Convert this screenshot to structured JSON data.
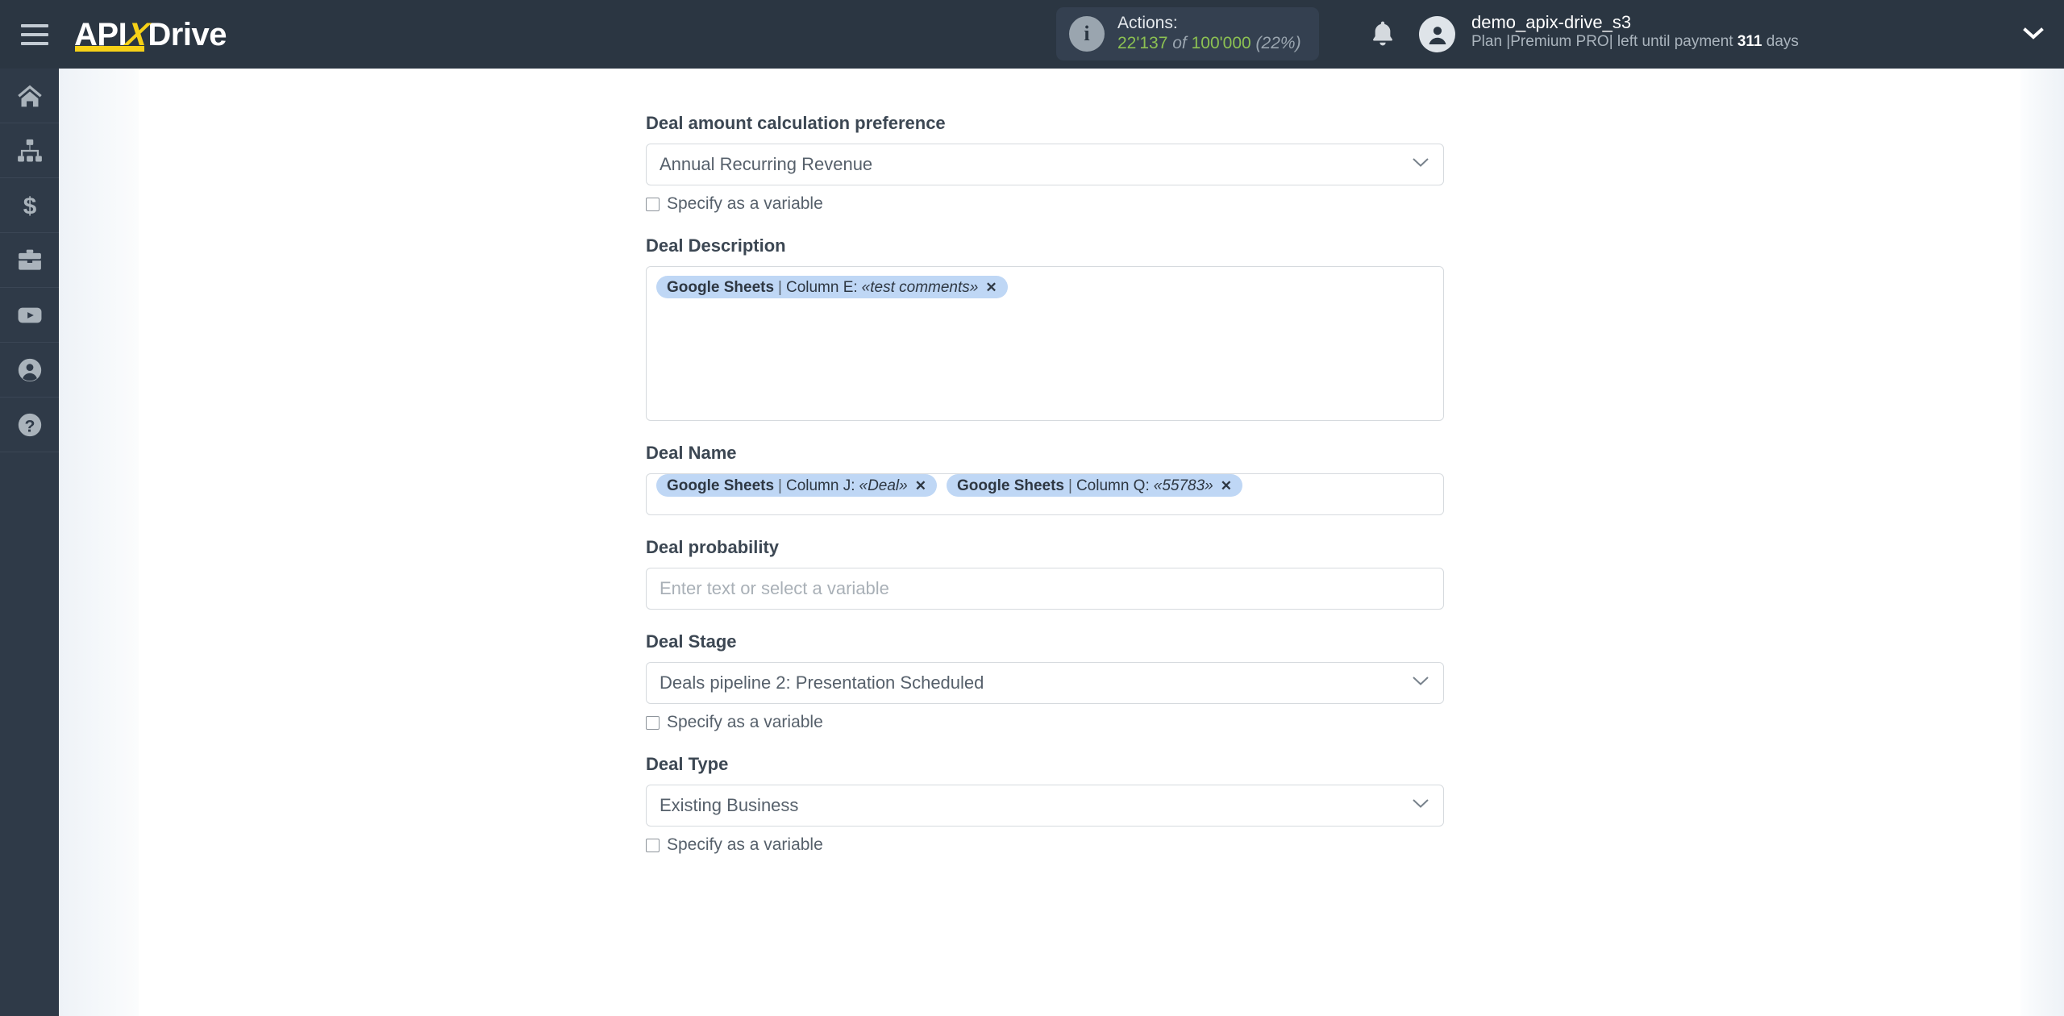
{
  "header": {
    "logo": {
      "part1": "API",
      "part2": "X",
      "part3": "Drive"
    },
    "menu_icon": "hamburger-icon",
    "actions": {
      "title": "Actions:",
      "used": "22'137",
      "of": "of",
      "total": "100'000",
      "percent": "(22%)",
      "green_color": "#8cc152"
    },
    "notifications_icon": "bell-icon",
    "user": {
      "name": "demo_apix-drive_s3",
      "plan_prefix": "Plan |",
      "plan_name": "Premium PRO",
      "plan_mid": "| left until payment",
      "days_value": "311",
      "days_suffix": "days"
    },
    "dropdown_icon": "chevron-down-icon"
  },
  "sidebar": {
    "items": [
      {
        "name": "home",
        "icon": "home-icon"
      },
      {
        "name": "connections",
        "icon": "sitemap-icon"
      },
      {
        "name": "billing",
        "icon": "dollar-icon"
      },
      {
        "name": "services",
        "icon": "briefcase-icon"
      },
      {
        "name": "video",
        "icon": "youtube-icon"
      },
      {
        "name": "account",
        "icon": "user-circle-icon"
      },
      {
        "name": "help",
        "icon": "question-circle-icon"
      }
    ]
  },
  "form": {
    "checkbox_label": "Specify as a variable",
    "fields": [
      {
        "id": "deal-amount-calculation-preference",
        "label": "Deal amount calculation preference",
        "type": "select",
        "value": "Annual Recurring Revenue",
        "has_checkbox": true
      },
      {
        "id": "deal-description",
        "label": "Deal Description",
        "type": "tagarea-tall",
        "tags": [
          {
            "source": "Google Sheets",
            "sep": "|",
            "column": "Column E:",
            "value": "«test comments»",
            "remove": "✕"
          }
        ],
        "has_checkbox": false
      },
      {
        "id": "deal-name",
        "label": "Deal Name",
        "type": "tagarea-short",
        "tags": [
          {
            "source": "Google Sheets",
            "sep": "|",
            "column": "Column J:",
            "value": "«Deal»",
            "remove": "✕"
          },
          {
            "source": "Google Sheets",
            "sep": "|",
            "column": "Column Q:",
            "value": "«55783»",
            "remove": "✕"
          }
        ],
        "has_checkbox": false
      },
      {
        "id": "deal-probability",
        "label": "Deal probability",
        "type": "text",
        "value": "",
        "placeholder": "Enter text or select a variable",
        "has_checkbox": false
      },
      {
        "id": "deal-stage",
        "label": "Deal Stage",
        "type": "select",
        "value": "Deals pipeline 2: Presentation Scheduled",
        "has_checkbox": true
      },
      {
        "id": "deal-type",
        "label": "Deal Type",
        "type": "select",
        "value": "Existing Business",
        "has_checkbox": true
      }
    ]
  }
}
